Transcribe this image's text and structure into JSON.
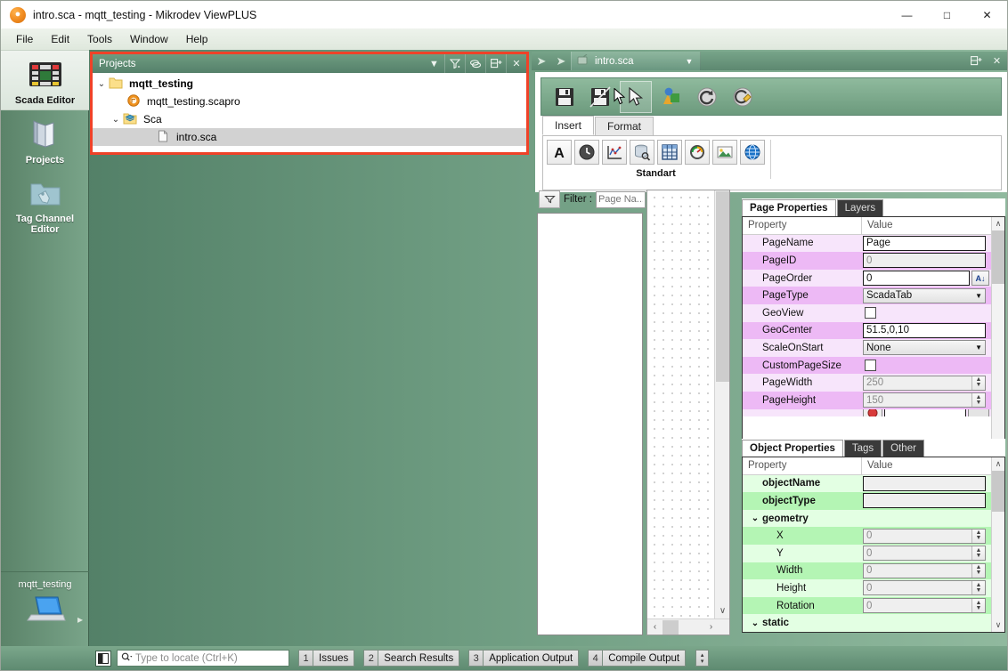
{
  "window": {
    "title": "intro.sca - mqtt_testing - Mikrodev ViewPLUS",
    "app_icon": "app-logo-icon",
    "minimize": "—",
    "maximize": "□",
    "close": "✕"
  },
  "menubar": {
    "items": [
      {
        "label": "File"
      },
      {
        "label": "Edit"
      },
      {
        "label": "Tools"
      },
      {
        "label": "Window"
      },
      {
        "label": "Help"
      }
    ]
  },
  "leftbar": {
    "items": [
      {
        "label": "Scada Editor",
        "icon": "scada-editor-icon",
        "active": true
      },
      {
        "label": "Projects",
        "icon": "projects-book-icon",
        "active": false
      },
      {
        "label": "Tag Channel Editor",
        "icon": "tag-channel-folder-icon",
        "active": false
      }
    ],
    "bottom": {
      "label": "mqtt_testing",
      "icon": "laptop-icon",
      "expand": "▸"
    }
  },
  "projects_panel": {
    "title": "Projects",
    "header_icons": [
      {
        "name": "chevron-down-icon",
        "glyph": "▼"
      },
      {
        "name": "filter-icon",
        "glyph": "∇"
      },
      {
        "name": "link-icon",
        "glyph": "⊝"
      },
      {
        "name": "new-window-icon",
        "glyph": "⧉"
      },
      {
        "name": "close-icon",
        "glyph": "✕"
      }
    ],
    "tree": [
      {
        "label": "mqtt_testing",
        "icon": "folder-icon",
        "indent": 0,
        "twisty": "⌄",
        "bold": true,
        "selected": false
      },
      {
        "label": "mqtt_testing.scapro",
        "icon": "project-file-icon",
        "indent": 1,
        "twisty": "",
        "bold": false,
        "selected": false
      },
      {
        "label": "Sca",
        "icon": "sca-folder-icon",
        "indent": 1,
        "twisty": "⌄",
        "bold": false,
        "selected": false
      },
      {
        "label": "intro.sca",
        "icon": "document-icon",
        "indent": 2,
        "twisty": "",
        "bold": false,
        "selected": true
      }
    ]
  },
  "editor_nav": {
    "back": "←",
    "forward": "→",
    "tab_label": "intro.sca",
    "tab_icon": "sca-file-icon",
    "dropdown": "▼",
    "new_window": "⧉",
    "close": "✕"
  },
  "ribbon": {
    "toolbar": [
      {
        "name": "save-button",
        "icon": "floppy-save-icon",
        "pressed": false
      },
      {
        "name": "save-all-button",
        "icon": "floppy-save-all-icon",
        "pressed": false
      },
      {
        "name": "select-pointer-button",
        "icon": "cursor-arrow-icon",
        "pressed": true
      },
      {
        "name": "shapes-button",
        "icon": "shapes-3d-icon",
        "pressed": false
      },
      {
        "name": "refresh-button",
        "icon": "refresh-circle-icon",
        "pressed": false
      },
      {
        "name": "clean-button",
        "icon": "clean-broom-icon",
        "pressed": false
      }
    ],
    "tabs": [
      {
        "label": "Insert",
        "active": true
      },
      {
        "label": "Format",
        "active": false
      }
    ],
    "insert_group": {
      "label": "Standart",
      "buttons": [
        {
          "name": "insert-text-button",
          "icon": "letter-a-icon"
        },
        {
          "name": "insert-clock-button",
          "icon": "clock-icon"
        },
        {
          "name": "insert-trend-button",
          "icon": "line-chart-icon"
        },
        {
          "name": "insert-database-button",
          "icon": "database-search-icon"
        },
        {
          "name": "insert-table-button",
          "icon": "table-grid-icon"
        },
        {
          "name": "insert-gauge-button",
          "icon": "gauge-icon"
        },
        {
          "name": "insert-image-button",
          "icon": "picture-icon"
        },
        {
          "name": "insert-web-button",
          "icon": "globe-icon"
        }
      ]
    }
  },
  "filter": {
    "button_icon": "filter-funnel-icon",
    "label": "Filter :",
    "placeholder": "Page Na..."
  },
  "canvas": {
    "scroll_up": "∧",
    "scroll_down": "∨",
    "scroll_left": "‹",
    "scroll_right": "›"
  },
  "page_properties": {
    "tabs": [
      {
        "label": "Page Properties",
        "active": true
      },
      {
        "label": "Layers",
        "active": false
      }
    ],
    "columns": {
      "name": "Property",
      "value": "Value"
    },
    "rows": [
      {
        "name": "PageName",
        "value": "Page",
        "kind": "input",
        "tint": "tint-p-a",
        "readonly": false
      },
      {
        "name": "PageID",
        "value": "0",
        "kind": "input",
        "tint": "tint-p-b",
        "readonly": true
      },
      {
        "name": "PageOrder",
        "value": "0",
        "kind": "input-sort",
        "tint": "tint-p-a",
        "readonly": false,
        "button": "sort-az-icon"
      },
      {
        "name": "PageType",
        "value": "ScadaTab",
        "kind": "combo",
        "tint": "tint-p-b",
        "readonly": false
      },
      {
        "name": "GeoView",
        "value": "",
        "kind": "checkbox",
        "tint": "tint-p-a",
        "checked": false
      },
      {
        "name": "GeoCenter",
        "value": "51.5,0,10",
        "kind": "input",
        "tint": "tint-p-b",
        "readonly": false
      },
      {
        "name": "ScaleOnStart",
        "value": "None",
        "kind": "combo",
        "tint": "tint-p-a",
        "readonly": false
      },
      {
        "name": "CustomPageSize",
        "value": "",
        "kind": "checkbox",
        "tint": "tint-p-b",
        "checked": false
      },
      {
        "name": "PageWidth",
        "value": "250",
        "kind": "spin",
        "tint": "tint-p-a",
        "readonly": true
      },
      {
        "name": "PageHeight",
        "value": "150",
        "kind": "spin",
        "tint": "tint-p-b",
        "readonly": true
      }
    ],
    "scroll": {
      "up": "∧",
      "down": "∨"
    }
  },
  "object_properties": {
    "tabs": [
      {
        "label": "Object Properties",
        "active": true
      },
      {
        "label": "Tags",
        "active": false
      },
      {
        "label": "Other",
        "active": false
      }
    ],
    "columns": {
      "name": "Property",
      "value": "Value"
    },
    "rows": [
      {
        "name": "objectName",
        "value": "",
        "kind": "input",
        "tint": "tint-g-a",
        "indent": 1,
        "bold": true
      },
      {
        "name": "objectType",
        "value": "",
        "kind": "input",
        "tint": "tint-g-b",
        "indent": 1,
        "bold": true
      },
      {
        "name": "geometry",
        "value": "",
        "kind": "group",
        "tint": "tint-g-a",
        "indent": 0,
        "bold": true,
        "twisty": "⌄"
      },
      {
        "name": "X",
        "value": "0",
        "kind": "spin",
        "tint": "tint-g-b",
        "indent": 2,
        "bold": false
      },
      {
        "name": "Y",
        "value": "0",
        "kind": "spin",
        "tint": "tint-g-a",
        "indent": 2,
        "bold": false
      },
      {
        "name": "Width",
        "value": "0",
        "kind": "spin",
        "tint": "tint-g-b",
        "indent": 2,
        "bold": false
      },
      {
        "name": "Height",
        "value": "0",
        "kind": "spin",
        "tint": "tint-g-a",
        "indent": 2,
        "bold": false
      },
      {
        "name": "Rotation",
        "value": "0",
        "kind": "spin",
        "tint": "tint-g-b",
        "indent": 2,
        "bold": false
      },
      {
        "name": "static",
        "value": "",
        "kind": "group",
        "tint": "tint-g-a",
        "indent": 0,
        "bold": true,
        "twisty": "⌄"
      }
    ],
    "scroll": {
      "up": "∧",
      "down": "∨"
    }
  },
  "statusbar": {
    "toggle_icon": "panel-toggle-icon",
    "search_icon": "search-icon",
    "search_placeholder": "Type to locate (Ctrl+K)",
    "items": [
      {
        "num": "1",
        "label": "Issues"
      },
      {
        "num": "2",
        "label": "Search Results"
      },
      {
        "num": "3",
        "label": "Application Output"
      },
      {
        "num": "4",
        "label": "Compile Output"
      }
    ],
    "spinner": {
      "up": "▴",
      "down": "▾"
    }
  },
  "colors": {
    "highlight_red": "#ef4228",
    "chrome_green": "#6d9b80",
    "panel_white": "#ffffff",
    "property_pink": "#edb9f5",
    "property_green": "#b4f5b4"
  }
}
